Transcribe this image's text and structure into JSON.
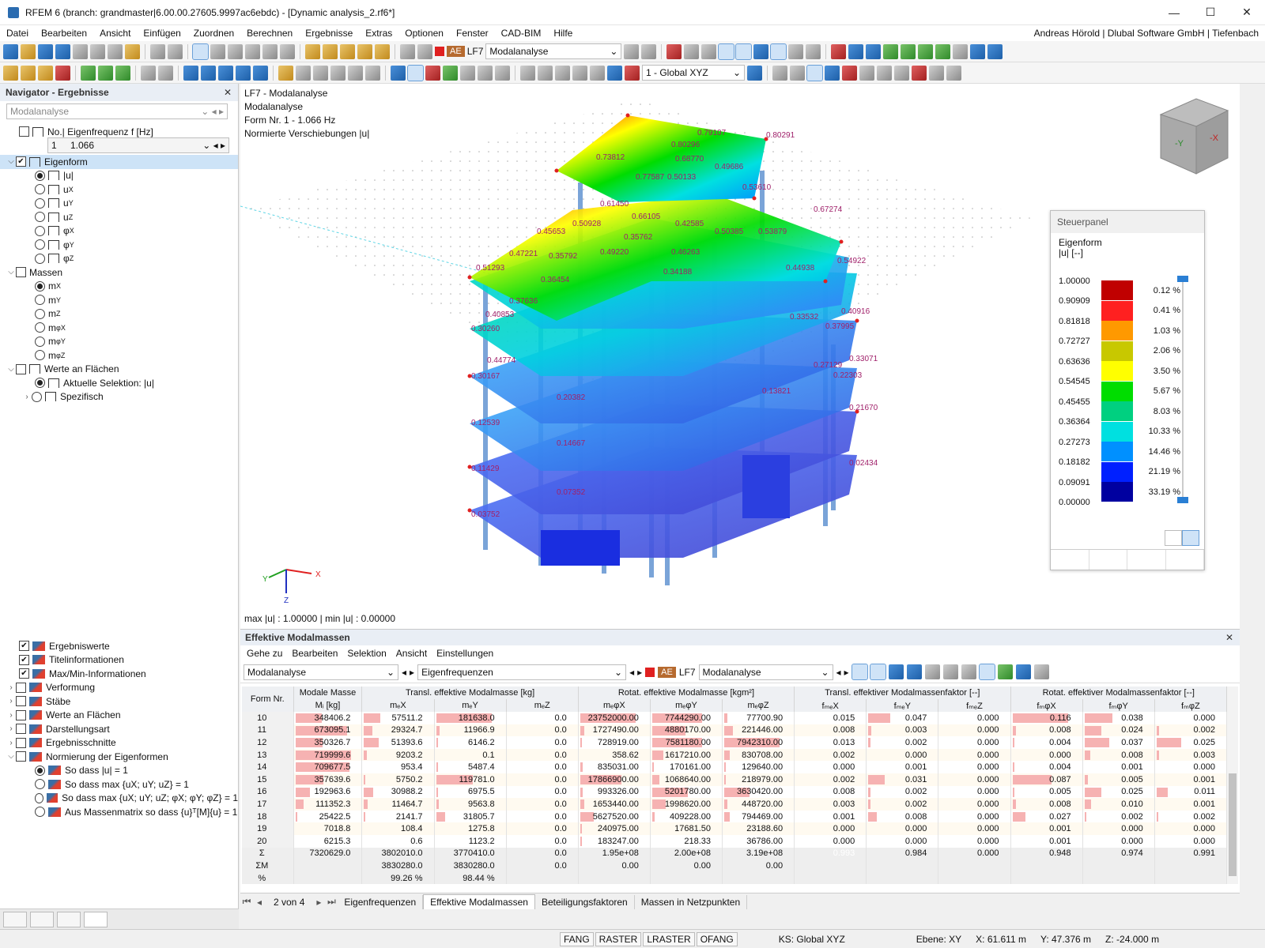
{
  "window": {
    "title": "RFEM 6 (branch: grandmaster|6.00.00.27605.9997ac6ebdc) - [Dynamic analysis_2.rf6*]"
  },
  "menu": {
    "items": [
      "Datei",
      "Bearbeiten",
      "Ansicht",
      "Einfügen",
      "Zuordnen",
      "Berechnen",
      "Ergebnisse",
      "Extras",
      "Optionen",
      "Fenster",
      "CAD-BIM",
      "Hilfe"
    ],
    "user": "Andreas Hörold | Dlubal Software GmbH | Tiefenbach"
  },
  "toolbar": {
    "ae": "AE",
    "lf": "LF7",
    "analysis": "Modalanalyse",
    "coord": "1 - Global XYZ"
  },
  "navigator": {
    "title": "Navigator - Ergebnisse",
    "combo": "Modalanalyse",
    "freq_label": "No.| Eigenfrequenz f [Hz]",
    "freq_no": "1",
    "freq_val": "1.066",
    "eigenform": "Eigenform",
    "eigen_items": [
      "|u|",
      "u",
      "u",
      "u",
      "φ",
      "φ",
      "φ"
    ],
    "eigen_subs": [
      "",
      "X",
      "Y",
      "Z",
      "X",
      "Y",
      "Z"
    ],
    "massen": "Massen",
    "mass_items": [
      "m",
      "m",
      "m",
      "m",
      "m",
      "m"
    ],
    "mass_subs": [
      "X",
      "Y",
      "Z",
      "φX",
      "φY",
      "φZ"
    ],
    "werte": "Werte an Flächen",
    "aktuelle": "Aktuelle Selektion: |u|",
    "spezifisch": "Spezifisch",
    "bottom": [
      "Ergebniswerte",
      "Titelinformationen",
      "Max/Min-Informationen",
      "Verformung",
      "Stäbe",
      "Werte an Flächen",
      "Darstellungsart",
      "Ergebnisschnitte",
      "Normierung der Eigenformen"
    ],
    "norm": [
      "So dass |u| = 1",
      "So dass max {uX; uY; uZ} = 1",
      "So dass max {uX; uY; uZ; φX; φY; φZ} = 1",
      "Aus Massenmatrix so dass {u}ᵀ[M]{u} = 1"
    ]
  },
  "viewport": {
    "lines": [
      "LF7 - Modalanalyse",
      "Modalanalyse",
      "Form Nr. 1 - 1.066 Hz",
      "Normierte Verschiebungen |u|"
    ],
    "maxmin": "max |u| : 1.00000 | min |u| : 0.00000",
    "labels": [
      "0.80291",
      "0.79107",
      "0.80296",
      "0.73812",
      "0.68770",
      "0.49686",
      "0.77587",
      "0.50133",
      "0.53610",
      "0.67274",
      "0.61450",
      "0.66105",
      "0.50928",
      "0.45653",
      "0.42585",
      "0.35762",
      "0.50385",
      "0.53879",
      "0.47221",
      "0.35792",
      "0.51293",
      "0.49220",
      "0.36454",
      "0.34188",
      "0.46263",
      "0.44938",
      "0.54922",
      "0.37636",
      "0.40853",
      "0.33532",
      "0.40916",
      "0.37995",
      "0.30260",
      "0.44774",
      "0.30167",
      "0.33071",
      "0.27129",
      "0.22303",
      "0.20382",
      "0.13821",
      "0.12539",
      "0.21670",
      "0.14667",
      "0.07352",
      "0.02434",
      "0.11429",
      "0.03752"
    ],
    "axes": {
      "x": "X",
      "y": "Y",
      "z": "Z"
    }
  },
  "panel": {
    "title": "Steuerpanel",
    "caption": "Eigenform",
    "unit": "|u| [--]",
    "values": [
      "1.00000",
      "0.90909",
      "0.81818",
      "0.72727",
      "0.63636",
      "0.54545",
      "0.45455",
      "0.36364",
      "0.27273",
      "0.18182",
      "0.09091",
      "0.00000"
    ],
    "percents": [
      "0.12 %",
      "0.41 %",
      "1.03 %",
      "2.06 %",
      "3.50 %",
      "5.67 %",
      "8.03 %",
      "10.33 %",
      "14.46 %",
      "21.19 %",
      "33.19 %"
    ],
    "colors": [
      "#c00000",
      "#ff2020",
      "#ff9900",
      "#c8c800",
      "#ffff00",
      "#00dd00",
      "#00d080",
      "#00e0e0",
      "#0090ff",
      "#0020ff",
      "#0000a0"
    ]
  },
  "results": {
    "title": "Effektive Modalmassen",
    "menu": [
      "Gehe zu",
      "Bearbeiten",
      "Selektion",
      "Ansicht",
      "Einstellungen"
    ],
    "combo1": "Modalanalyse",
    "combo2": "Eigenfrequenzen",
    "ae": "AE",
    "lf": "LF7",
    "combo3": "Modalanalyse",
    "groups": [
      "Form Nr.",
      "Modale Masse",
      "Transl. effektive Modalmasse [kg]",
      "Rotat. effektive Modalmasse [kgm²]",
      "Transl. effektiver Modalmassenfaktor [--]",
      "Rotat. effektiver Modalmassenfaktor [--]"
    ],
    "cols": [
      "Mᵢ [kg]",
      "mₑX",
      "mₑY",
      "mₑZ",
      "mₑφX",
      "mₑφY",
      "mₑφZ",
      "fₘₑX",
      "fₘₑY",
      "fₘₑZ",
      "fₘφX",
      "fₘφY",
      "fₘφZ"
    ],
    "rows": [
      [
        "10",
        "348406.2",
        "57511.2",
        "181638.0",
        "0.0",
        "23752000.00",
        "7744290.00",
        "77700.90",
        "0.015",
        "0.047",
        "0.000",
        "0.116",
        "0.038",
        "0.000"
      ],
      [
        "11",
        "673095.1",
        "29324.7",
        "11966.9",
        "0.0",
        "1727490.00",
        "4880170.00",
        "221446.00",
        "0.008",
        "0.003",
        "0.000",
        "0.008",
        "0.024",
        "0.002"
      ],
      [
        "12",
        "350326.7",
        "51393.6",
        "6146.2",
        "0.0",
        "728919.00",
        "7581180.00",
        "7942310.00",
        "0.013",
        "0.002",
        "0.000",
        "0.004",
        "0.037",
        "0.025"
      ],
      [
        "13",
        "719999.6",
        "9203.2",
        "0.1",
        "0.0",
        "358.62",
        "1617210.00",
        "830708.00",
        "0.002",
        "0.000",
        "0.000",
        "0.000",
        "0.008",
        "0.003"
      ],
      [
        "14",
        "709677.5",
        "953.4",
        "5487.4",
        "0.0",
        "835031.00",
        "170161.00",
        "129640.00",
        "0.000",
        "0.001",
        "0.000",
        "0.004",
        "0.001",
        "0.000"
      ],
      [
        "15",
        "357639.6",
        "5750.2",
        "119781.0",
        "0.0",
        "17866900.00",
        "1068640.00",
        "218979.00",
        "0.002",
        "0.031",
        "0.000",
        "0.087",
        "0.005",
        "0.001"
      ],
      [
        "16",
        "192963.6",
        "30988.2",
        "6975.5",
        "0.0",
        "993326.00",
        "5201780.00",
        "3630420.00",
        "0.008",
        "0.002",
        "0.000",
        "0.005",
        "0.025",
        "0.011"
      ],
      [
        "17",
        "111352.3",
        "11464.7",
        "9563.8",
        "0.0",
        "1653440.00",
        "1998620.00",
        "448720.00",
        "0.003",
        "0.002",
        "0.000",
        "0.008",
        "0.010",
        "0.001"
      ],
      [
        "18",
        "25422.5",
        "2141.7",
        "31805.7",
        "0.0",
        "5627520.00",
        "409228.00",
        "794469.00",
        "0.001",
        "0.008",
        "0.000",
        "0.027",
        "0.002",
        "0.002"
      ],
      [
        "19",
        "7018.8",
        "108.4",
        "1275.8",
        "0.0",
        "240975.00",
        "17681.50",
        "23188.60",
        "0.000",
        "0.000",
        "0.000",
        "0.001",
        "0.000",
        "0.000"
      ],
      [
        "20",
        "6215.3",
        "0.6",
        "1123.2",
        "0.0",
        "183247.00",
        "218.33",
        "36786.00",
        "0.000",
        "0.000",
        "0.000",
        "0.001",
        "0.000",
        "0.000"
      ]
    ],
    "bars": [
      [
        0.48,
        0.3,
        1,
        0,
        1,
        0.9,
        0.05,
        0,
        0.4,
        0,
        1,
        0.5,
        0
      ],
      [
        0.93,
        0.15,
        0.07,
        0,
        0.07,
        0.6,
        0.15,
        0,
        0.05,
        0,
        0.07,
        0.3,
        0.05
      ],
      [
        0.49,
        0.27,
        0.03,
        0,
        0.03,
        0.9,
        1,
        0,
        0.04,
        0,
        0.03,
        0.45,
        0.45
      ],
      [
        1,
        0.05,
        0,
        0,
        0,
        0.2,
        0.1,
        0,
        0,
        0,
        0,
        0.1,
        0.05
      ],
      [
        0.98,
        0,
        0.03,
        0,
        0.04,
        0.02,
        0.02,
        0,
        0,
        0,
        0.03,
        0,
        0
      ],
      [
        0.5,
        0.03,
        0.66,
        0,
        0.75,
        0.13,
        0.03,
        0,
        0.3,
        0,
        0.7,
        0.06,
        0
      ],
      [
        0.27,
        0.16,
        0.04,
        0,
        0.04,
        0.65,
        0.45,
        0,
        0.04,
        0,
        0.04,
        0.3,
        0.2
      ],
      [
        0.15,
        0.06,
        0.05,
        0,
        0.07,
        0.25,
        0.06,
        0,
        0.04,
        0,
        0.07,
        0.12,
        0
      ],
      [
        0.04,
        0.01,
        0.17,
        0,
        0.24,
        0.05,
        0.1,
        0,
        0.16,
        0,
        0.23,
        0.03,
        0.03
      ],
      [
        0,
        0,
        0,
        0,
        0.01,
        0,
        0,
        0,
        0,
        0,
        0,
        0,
        0
      ],
      [
        0,
        0,
        0,
        0,
        0.01,
        0,
        0,
        0,
        0,
        0,
        0,
        0,
        0
      ]
    ],
    "sum": {
      "label": "Σ",
      "vals": [
        "7320629.0",
        "3802010.0",
        "3770410.0",
        "0.0",
        "1.95e+08",
        "2.00e+08",
        "3.19e+08",
        "0.993",
        "0.984",
        "0.000",
        "0.948",
        "0.974",
        "0.991"
      ]
    },
    "summ": {
      "label": "ΣM",
      "vals": [
        "",
        "3830280.0",
        "3830280.0",
        "0.0",
        "0.00",
        "0.00",
        "0.00",
        "",
        "",
        "",
        "",
        "",
        ""
      ]
    },
    "pct": {
      "label": "%",
      "vals": [
        "",
        "99.26 %",
        "98.44 %",
        "",
        "",
        "",
        "",
        "",
        "",
        "",
        "",
        "",
        ""
      ]
    },
    "pager": "2 von 4",
    "tabs": [
      "Eigenfrequenzen",
      "Effektive Modalmassen",
      "Beteiligungsfaktoren",
      "Massen in Netzpunkten"
    ]
  },
  "status": {
    "buttons": [
      "FANG",
      "RASTER",
      "LRASTER",
      "OFANG"
    ],
    "ks": "KS: Global XYZ",
    "ebene": "Ebene: XY",
    "x": "X: 61.611 m",
    "y": "Y: 47.376 m",
    "z": "Z: -24.000 m"
  }
}
